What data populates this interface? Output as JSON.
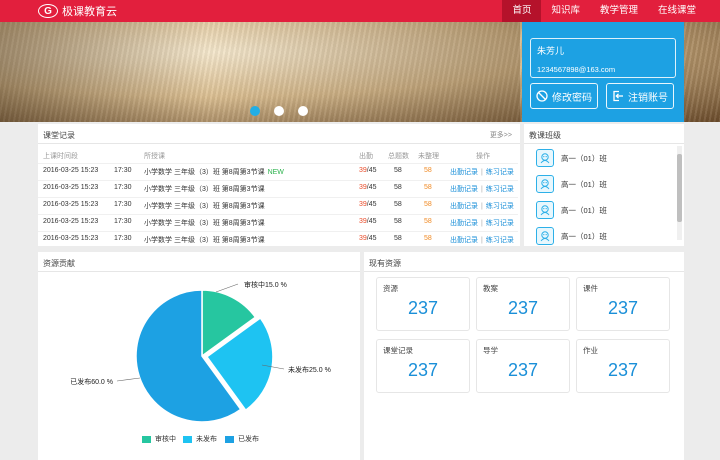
{
  "header": {
    "logo_letter": "G",
    "app_name": "极课教育云",
    "nav": [
      {
        "label": "首页",
        "active": true
      },
      {
        "label": "知识库",
        "active": false
      },
      {
        "label": "教学管理",
        "active": false
      },
      {
        "label": "在线课堂",
        "active": false
      }
    ]
  },
  "banner": {
    "slides": 3,
    "active_slide": 1
  },
  "user": {
    "name": "朱芳儿",
    "email": "1234567898@163.com",
    "change_password": "修改密码",
    "logout": "注销账号"
  },
  "records": {
    "title": "课堂记录",
    "more": "更多>>",
    "columns": [
      "上课时间段",
      "所授课",
      "出勤",
      "总题数",
      "未整理",
      "操作"
    ],
    "rows": [
      {
        "date": "2016-03-25 15:23",
        "time": "17:30",
        "course": "小学数学 三年级（3）班 第8周第3节课",
        "badge": "NEW",
        "att": "39",
        "att_total": "/45",
        "total": "58",
        "pending": "58"
      },
      {
        "date": "2016-03-25 15:23",
        "time": "17:30",
        "course": "小学数学 三年级（3）班 第8周第3节课",
        "badge": "",
        "att": "39",
        "att_total": "/45",
        "total": "58",
        "pending": "58"
      },
      {
        "date": "2016-03-25 15:23",
        "time": "17:30",
        "course": "小学数学 三年级（3）班 第8周第3节课",
        "badge": "",
        "att": "39",
        "att_total": "/45",
        "total": "58",
        "pending": "58"
      },
      {
        "date": "2016-03-25 15:23",
        "time": "17:30",
        "course": "小学数学 三年级（3）班 第8周第3节课",
        "badge": "",
        "att": "39",
        "att_total": "/45",
        "total": "58",
        "pending": "58"
      },
      {
        "date": "2016-03-25 15:23",
        "time": "17:30",
        "course": "小学数学 三年级（3）班 第8周第3节课",
        "badge": "",
        "att": "39",
        "att_total": "/45",
        "total": "58",
        "pending": "58"
      }
    ],
    "action_attendance": "出勤记录",
    "action_practice": "练习记录"
  },
  "classes": {
    "title": "教课班级",
    "items": [
      "高一（01）班",
      "高一（01）班",
      "高一（01）班",
      "高一（01）班"
    ]
  },
  "contribution": {
    "title": "资源贡献",
    "legend": [
      "审核中",
      "未发布",
      "已发布"
    ],
    "colors": [
      "#26c6a0",
      "#1ec3f2",
      "#1da1e3"
    ]
  },
  "chart_data": {
    "type": "pie",
    "categories": [
      "审核中",
      "未发布",
      "已发布"
    ],
    "values": [
      15.0,
      25.0,
      60.0
    ],
    "labels": [
      "审核中15.0 %",
      "未发布25.0 %",
      "已发布60.0 %"
    ]
  },
  "resources": {
    "title": "现有资源",
    "cards": [
      {
        "label": "资源",
        "value": "237"
      },
      {
        "label": "教案",
        "value": "237"
      },
      {
        "label": "课件",
        "value": "237"
      },
      {
        "label": "课堂记录",
        "value": "237"
      },
      {
        "label": "导学",
        "value": "237"
      },
      {
        "label": "作业",
        "value": "237"
      }
    ]
  }
}
